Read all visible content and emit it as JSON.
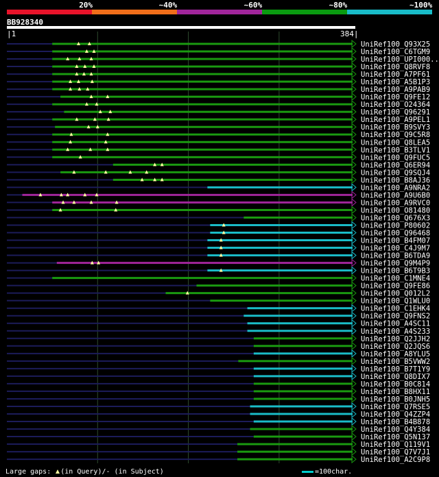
{
  "legend": {
    "labels": [
      "20%",
      "~40%",
      "~60%",
      "~80%",
      "~100%"
    ],
    "colors": [
      "#e8132a",
      "#f06e1a",
      "#a0259a",
      "#0a9a10",
      "#19bcc8"
    ]
  },
  "query": {
    "name": "BB928340",
    "start": "1",
    "end": "384",
    "length": 384
  },
  "scale_note": "=100char.",
  "footer": {
    "prefix": "Large gaps:",
    "query_gap": "(in Query)",
    "separator": "/",
    "subject_gap": "-  (in Subject)"
  },
  "colors": {
    "green": "#1a9a10",
    "cyan": "#1abcc8",
    "purple": "#a0259a",
    "faint": "#1c1c5a",
    "gap": "#ffffa0",
    "vgrid": "#2e4a2e"
  },
  "hits": [
    {
      "name": "UniRef100_Q93X25",
      "color": "green",
      "start": 50,
      "end": 384,
      "faint_start": 0,
      "query_gaps": [
        79,
        91
      ]
    },
    {
      "name": "UniRef100_C6TGM9",
      "color": "green",
      "start": 50,
      "end": 384,
      "faint_start": 0,
      "query_gaps": [
        88,
        96
      ]
    },
    {
      "name": "UniRef100_UPI000..",
      "color": "green",
      "start": 50,
      "end": 384,
      "faint_start": 0,
      "query_gaps": [
        67,
        80,
        93
      ]
    },
    {
      "name": "UniRef100_Q8RVF8",
      "color": "green",
      "start": 50,
      "end": 384,
      "faint_start": 0,
      "query_gaps": [
        77,
        86,
        96
      ]
    },
    {
      "name": "UniRef100_A7PF61",
      "color": "green",
      "start": 50,
      "end": 384,
      "faint_start": 0,
      "query_gaps": [
        77,
        85,
        93
      ]
    },
    {
      "name": "UniRef100_A5B1P3",
      "color": "green",
      "start": 50,
      "end": 384,
      "faint_start": 0,
      "query_gaps": [
        70,
        79,
        94
      ]
    },
    {
      "name": "UniRef100_A9PAB9",
      "color": "green",
      "start": 50,
      "end": 384,
      "faint_start": 0,
      "query_gaps": [
        70,
        80,
        89
      ]
    },
    {
      "name": "UniRef100_Q9FE12",
      "color": "green",
      "start": 59,
      "end": 384,
      "faint_start": 0,
      "query_gaps": [
        93,
        111
      ]
    },
    {
      "name": "UniRef100_O24364",
      "color": "green",
      "start": 50,
      "end": 384,
      "faint_start": 0,
      "query_gaps": [
        88,
        99
      ]
    },
    {
      "name": "UniRef100_Q96291",
      "color": "green",
      "start": 63,
      "end": 384,
      "faint_start": 0,
      "query_gaps": [
        103,
        114
      ]
    },
    {
      "name": "UniRef100_A9PEL1",
      "color": "green",
      "start": 50,
      "end": 384,
      "faint_start": 0,
      "query_gaps": [
        77,
        97,
        112
      ]
    },
    {
      "name": "UniRef100_B9SVY3",
      "color": "green",
      "start": 53,
      "end": 384,
      "faint_start": 0,
      "query_gaps": [
        90,
        100
      ]
    },
    {
      "name": "UniRef100_Q9C5R8",
      "color": "green",
      "start": 50,
      "end": 384,
      "faint_start": 0,
      "query_gaps": [
        71,
        111
      ]
    },
    {
      "name": "UniRef100_Q8LEA5",
      "color": "green",
      "start": 50,
      "end": 384,
      "faint_start": 0,
      "query_gaps": [
        70,
        109
      ]
    },
    {
      "name": "UniRef100_B3TLV1",
      "color": "green",
      "start": 50,
      "end": 384,
      "faint_start": 0,
      "query_gaps": [
        67,
        92,
        111
      ]
    },
    {
      "name": "UniRef100_Q9FUC5",
      "color": "green",
      "start": 50,
      "end": 384,
      "faint_start": 0,
      "query_gaps": [
        81
      ]
    },
    {
      "name": "UniRef100_Q6ER94",
      "color": "green",
      "start": 117,
      "end": 384,
      "faint_start": 0,
      "query_gaps": [
        163,
        171
      ]
    },
    {
      "name": "UniRef100_Q9SQJ4",
      "color": "green",
      "start": 59,
      "end": 384,
      "faint_start": 0,
      "query_gaps": [
        74,
        109,
        136,
        154
      ]
    },
    {
      "name": "UniRef100_B8AJ36",
      "color": "green",
      "start": 117,
      "end": 384,
      "faint_start": 0,
      "query_gaps": [
        149,
        163,
        171
      ]
    },
    {
      "name": "UniRef100_A9NRA2",
      "color": "cyan",
      "start": 221,
      "end": 384,
      "faint_start": 0,
      "query_gaps": []
    },
    {
      "name": "UniRef100_A9U6B0",
      "color": "purple",
      "start": 17,
      "end": 384,
      "faint_start": 0,
      "query_gaps": [
        37,
        60,
        67,
        86,
        99
      ]
    },
    {
      "name": "UniRef100_A9RVC0",
      "color": "purple",
      "start": 50,
      "end": 384,
      "faint_start": 0,
      "query_gaps": [
        62,
        74,
        93,
        121
      ]
    },
    {
      "name": "UniRef100_O81480",
      "color": "green",
      "start": 50,
      "end": 384,
      "faint_start": 0,
      "query_gaps": [
        59,
        120
      ]
    },
    {
      "name": "UniRef100_Q676X3",
      "color": "green",
      "start": 261,
      "end": 384,
      "faint_start": 0,
      "query_gaps": []
    },
    {
      "name": "UniRef100_P80602",
      "color": "cyan",
      "start": 224,
      "end": 384,
      "faint_start": 0,
      "query_gaps": [
        239
      ]
    },
    {
      "name": "UniRef100_Q96468",
      "color": "cyan",
      "start": 224,
      "end": 384,
      "faint_start": 0,
      "query_gaps": [
        239
      ]
    },
    {
      "name": "UniRef100_B4FM07",
      "color": "cyan",
      "start": 221,
      "end": 384,
      "faint_start": 0,
      "query_gaps": [
        236
      ]
    },
    {
      "name": "UniRef100_C4J9M7",
      "color": "cyan",
      "start": 221,
      "end": 384,
      "faint_start": 0,
      "query_gaps": [
        236
      ]
    },
    {
      "name": "UniRef100_B6TDA9",
      "color": "cyan",
      "start": 221,
      "end": 384,
      "faint_start": 0,
      "query_gaps": [
        236
      ]
    },
    {
      "name": "UniRef100_Q9M4P9",
      "color": "purple",
      "start": 55,
      "end": 384,
      "faint_start": 0,
      "query_gaps": [
        94,
        101
      ]
    },
    {
      "name": "UniRef100_B6T9B3",
      "color": "cyan",
      "start": 221,
      "end": 384,
      "faint_start": 0,
      "query_gaps": [
        236
      ]
    },
    {
      "name": "UniRef100_C1MNE4",
      "color": "green",
      "start": 50,
      "end": 384,
      "faint_start": 0,
      "query_gaps": []
    },
    {
      "name": "UniRef100_Q9FE86",
      "color": "green",
      "start": 209,
      "end": 384,
      "faint_start": 0,
      "query_gaps": []
    },
    {
      "name": "UniRef100_Q012L2",
      "color": "green",
      "start": 175,
      "end": 384,
      "faint_start": 0,
      "query_gaps": [
        199
      ]
    },
    {
      "name": "UniRef100_Q1WLU0",
      "color": "green",
      "start": 224,
      "end": 384,
      "faint_start": 0,
      "query_gaps": []
    },
    {
      "name": "UniRef100_C1EHK4",
      "color": "cyan",
      "start": 265,
      "end": 384,
      "faint_start": 0,
      "query_gaps": []
    },
    {
      "name": "UniRef100_Q9FNS2",
      "color": "cyan",
      "start": 261,
      "end": 384,
      "faint_start": 0,
      "query_gaps": []
    },
    {
      "name": "UniRef100_A4SC11",
      "color": "cyan",
      "start": 265,
      "end": 384,
      "faint_start": 0,
      "query_gaps": []
    },
    {
      "name": "UniRef100_A4S233",
      "color": "cyan",
      "start": 265,
      "end": 384,
      "faint_start": 0,
      "query_gaps": []
    },
    {
      "name": "UniRef100_Q2JJH2",
      "color": "green",
      "start": 272,
      "end": 384,
      "faint_start": 0,
      "query_gaps": []
    },
    {
      "name": "UniRef100_Q2JQS6",
      "color": "green",
      "start": 272,
      "end": 384,
      "faint_start": 0,
      "query_gaps": []
    },
    {
      "name": "UniRef100_A8YLU5",
      "color": "cyan",
      "start": 272,
      "end": 384,
      "faint_start": 0,
      "query_gaps": []
    },
    {
      "name": "UniRef100_B5VWW2",
      "color": "green",
      "start": 255,
      "end": 384,
      "faint_start": 0,
      "query_gaps": []
    },
    {
      "name": "UniRef100_B7T1Y9",
      "color": "cyan",
      "start": 272,
      "end": 384,
      "faint_start": 0,
      "query_gaps": []
    },
    {
      "name": "UniRef100_Q8DIX7",
      "color": "cyan",
      "start": 272,
      "end": 384,
      "faint_start": 0,
      "query_gaps": []
    },
    {
      "name": "UniRef100_B0C814",
      "color": "green",
      "start": 272,
      "end": 384,
      "faint_start": 0,
      "query_gaps": []
    },
    {
      "name": "UniRef100_B8HX11",
      "color": "green",
      "start": 272,
      "end": 384,
      "faint_start": 0,
      "query_gaps": []
    },
    {
      "name": "UniRef100_B0JNH5",
      "color": "green",
      "start": 272,
      "end": 384,
      "faint_start": 0,
      "query_gaps": []
    },
    {
      "name": "UniRef100_Q7RSE5",
      "color": "cyan",
      "start": 268,
      "end": 384,
      "faint_start": 0,
      "query_gaps": []
    },
    {
      "name": "UniRef100_Q4ZZP4",
      "color": "cyan",
      "start": 268,
      "end": 384,
      "faint_start": 0,
      "query_gaps": []
    },
    {
      "name": "UniRef100_B4B878",
      "color": "cyan",
      "start": 272,
      "end": 384,
      "faint_start": 0,
      "query_gaps": []
    },
    {
      "name": "UniRef100_Q4Y384",
      "color": "green",
      "start": 268,
      "end": 384,
      "faint_start": 0,
      "query_gaps": []
    },
    {
      "name": "UniRef100_Q5N137",
      "color": "green",
      "start": 272,
      "end": 384,
      "faint_start": 0,
      "query_gaps": []
    },
    {
      "name": "UniRef100_Q119V1",
      "color": "green",
      "start": 254,
      "end": 384,
      "faint_start": 0,
      "query_gaps": []
    },
    {
      "name": "UniRef100_Q7V7J1",
      "color": "green",
      "start": 254,
      "end": 384,
      "faint_start": 0,
      "query_gaps": []
    },
    {
      "name": "UniRef100_A2C9P8",
      "color": "green",
      "start": 254,
      "end": 384,
      "faint_start": 0,
      "query_gaps": []
    }
  ]
}
